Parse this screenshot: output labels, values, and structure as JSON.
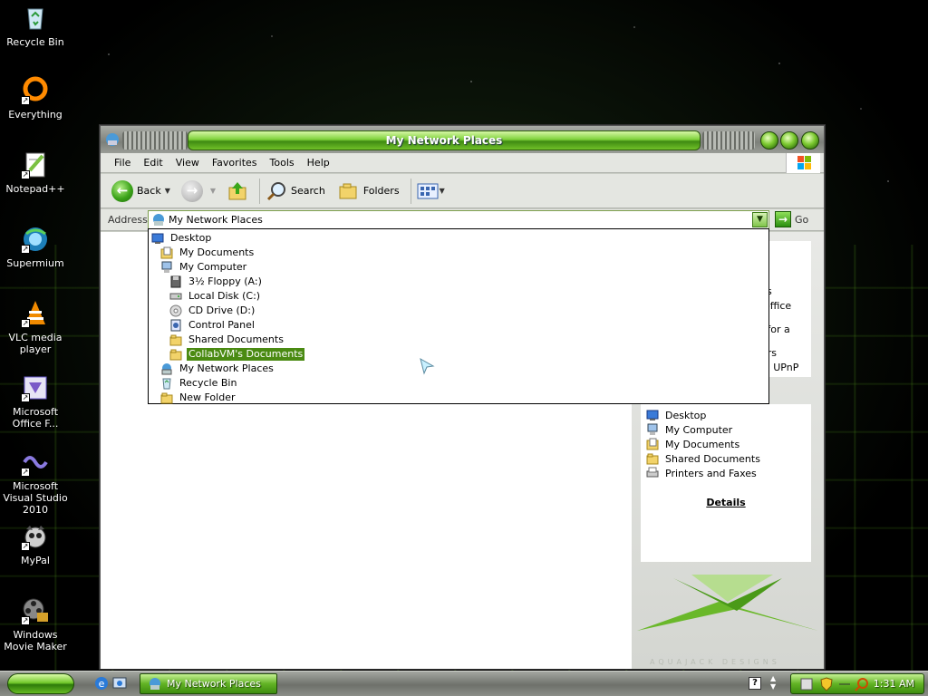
{
  "desktop": {
    "icons": [
      {
        "label": "Recycle Bin",
        "icon": "recycle-bin-icon"
      },
      {
        "label": "Everything",
        "icon": "everything-icon"
      },
      {
        "label": "Notepad++",
        "icon": "notepad-plus-plus-icon"
      },
      {
        "label": "Supermium",
        "icon": "supermium-icon"
      },
      {
        "label": "VLC media player",
        "icon": "vlc-icon"
      },
      {
        "label": "Microsoft Office F...",
        "icon": "office-icon"
      },
      {
        "label": "Microsoft Visual Studio 2010",
        "icon": "visual-studio-icon"
      },
      {
        "label": "MyPal",
        "icon": "mypal-icon"
      },
      {
        "label": "Windows Movie Maker",
        "icon": "movie-maker-icon"
      }
    ]
  },
  "window": {
    "title": "My Network Places",
    "menu": [
      "File",
      "Edit",
      "View",
      "Favorites",
      "Tools",
      "Help"
    ],
    "toolbar": {
      "back": "Back",
      "search": "Search",
      "folders": "Folders"
    },
    "address": {
      "label": "Address",
      "value": "My Network Places",
      "go": "Go"
    },
    "dropdown": [
      {
        "label": "Desktop",
        "indent": 0,
        "icon": "desktop-icon"
      },
      {
        "label": "My Documents",
        "indent": 1,
        "icon": "my-documents-icon"
      },
      {
        "label": "My Computer",
        "indent": 1,
        "icon": "my-computer-icon"
      },
      {
        "label": "3½ Floppy (A:)",
        "indent": 2,
        "icon": "floppy-icon"
      },
      {
        "label": "Local Disk (C:)",
        "indent": 2,
        "icon": "local-disk-icon"
      },
      {
        "label": "CD Drive (D:)",
        "indent": 2,
        "icon": "cd-drive-icon"
      },
      {
        "label": "Control Panel",
        "indent": 2,
        "icon": "control-panel-icon"
      },
      {
        "label": "Shared Documents",
        "indent": 2,
        "icon": "folder-icon"
      },
      {
        "label": "CollabVM's Documents",
        "indent": 2,
        "icon": "folder-icon",
        "selected": true
      },
      {
        "label": "My Network Places",
        "indent": 1,
        "icon": "network-places-icon"
      },
      {
        "label": "Recycle Bin",
        "indent": 1,
        "icon": "recycle-bin-icon"
      },
      {
        "label": "New Folder",
        "indent": 1,
        "icon": "folder-icon"
      }
    ],
    "taskpane": {
      "fragments": [
        "ns",
        "office",
        "rk for a",
        "ers",
        "ed UPnP"
      ],
      "other_places": [
        {
          "label": "Desktop",
          "icon": "desktop-icon"
        },
        {
          "label": "My Computer",
          "icon": "my-computer-icon"
        },
        {
          "label": "My Documents",
          "icon": "my-documents-icon"
        },
        {
          "label": "Shared Documents",
          "icon": "folder-icon"
        },
        {
          "label": "Printers and Faxes",
          "icon": "printer-icon"
        }
      ],
      "details": "Details",
      "brand": "AQUAJACK DESIGNS"
    }
  },
  "taskbar": {
    "task": "My Network Places",
    "clock": "1:31 AM",
    "help": "?"
  },
  "colors": {
    "accent_green": "#4a8a12",
    "title_green": "#7ed13a"
  }
}
